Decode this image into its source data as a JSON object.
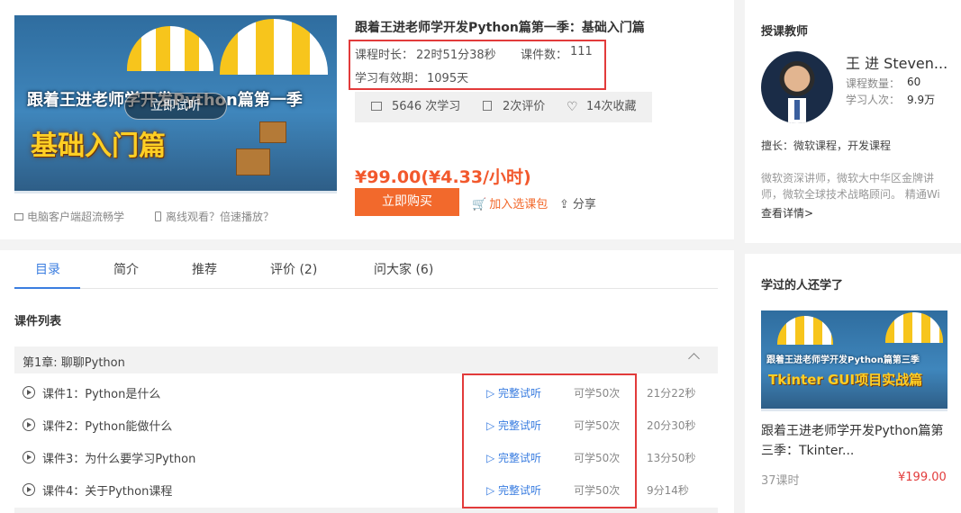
{
  "course": {
    "cover_line1": "跟着王进老师学开发Python篇第一季",
    "cover_line2": "基础入门篇",
    "cover_trial": "立即试听",
    "title": "跟着王进老师学开发Python篇第一季：基础入门篇",
    "duration_label": "课程时长：",
    "duration_value": "22时51分38秒",
    "lessons_label": "课件数：",
    "lessons_value": "111",
    "validity_label": "学习有效期：",
    "validity_value": "1095天",
    "stats": {
      "study_count": "5646 次学习",
      "reviews": "2次评价",
      "favorites": "14次收藏"
    },
    "price": "¥99.00(¥4.33/小时)",
    "buy_label": "立即购买",
    "add_label": "加入选课包",
    "share_label": "分享",
    "pc_client": "电脑客户端超流畅学",
    "offline": "离线观看？倍速播放？"
  },
  "tabs": [
    {
      "label": "目录",
      "active": true
    },
    {
      "label": "简介"
    },
    {
      "label": "推荐"
    },
    {
      "label": "评价 (2)"
    },
    {
      "label": "问大家 (6)"
    }
  ],
  "courseware": {
    "section_title": "课件列表",
    "chapter": "第1章:  聊聊Python",
    "lessons": [
      {
        "title": "课件1：Python是什么",
        "trial": "完整试听",
        "limit": "可学50次",
        "duration": "21分22秒"
      },
      {
        "title": "课件2：Python能做什么",
        "trial": "完整试听",
        "limit": "可学50次",
        "duration": "20分30秒"
      },
      {
        "title": "课件3：为什么要学习Python",
        "trial": "完整试听",
        "limit": "可学50次",
        "duration": "13分50秒"
      },
      {
        "title": "课件4：关于Python课程",
        "trial": "完整试听",
        "limit": "可学50次",
        "duration": "9分14秒"
      }
    ]
  },
  "teacher": {
    "panel_title": "授课教师",
    "name": "王 进 Steven...",
    "course_count_label": "课程数量：",
    "course_count": "60",
    "learners_label": "学习人次：",
    "learners": "9.9万",
    "specialty": "擅长：微软课程，开发课程",
    "bio": "微软资深讲师，微软大中华区金牌讲师，微软全球技术战略顾问。 精通Wi",
    "detail_link": "查看详情>"
  },
  "recommend": {
    "panel_title": "学过的人还学了",
    "img_line1": "跟着王进老师学开发Python篇第三季",
    "img_line2": "Tkinter GUI项目实战篇",
    "title": "跟着王进老师学开发Python篇第三季：Tkinter...",
    "hours": "37课时",
    "price": "¥199.00"
  },
  "colors": {
    "accent_orange": "#f2692c",
    "price_red": "#f2582c",
    "link_blue": "#3a7de0",
    "highlight_red": "#e23b3b"
  }
}
